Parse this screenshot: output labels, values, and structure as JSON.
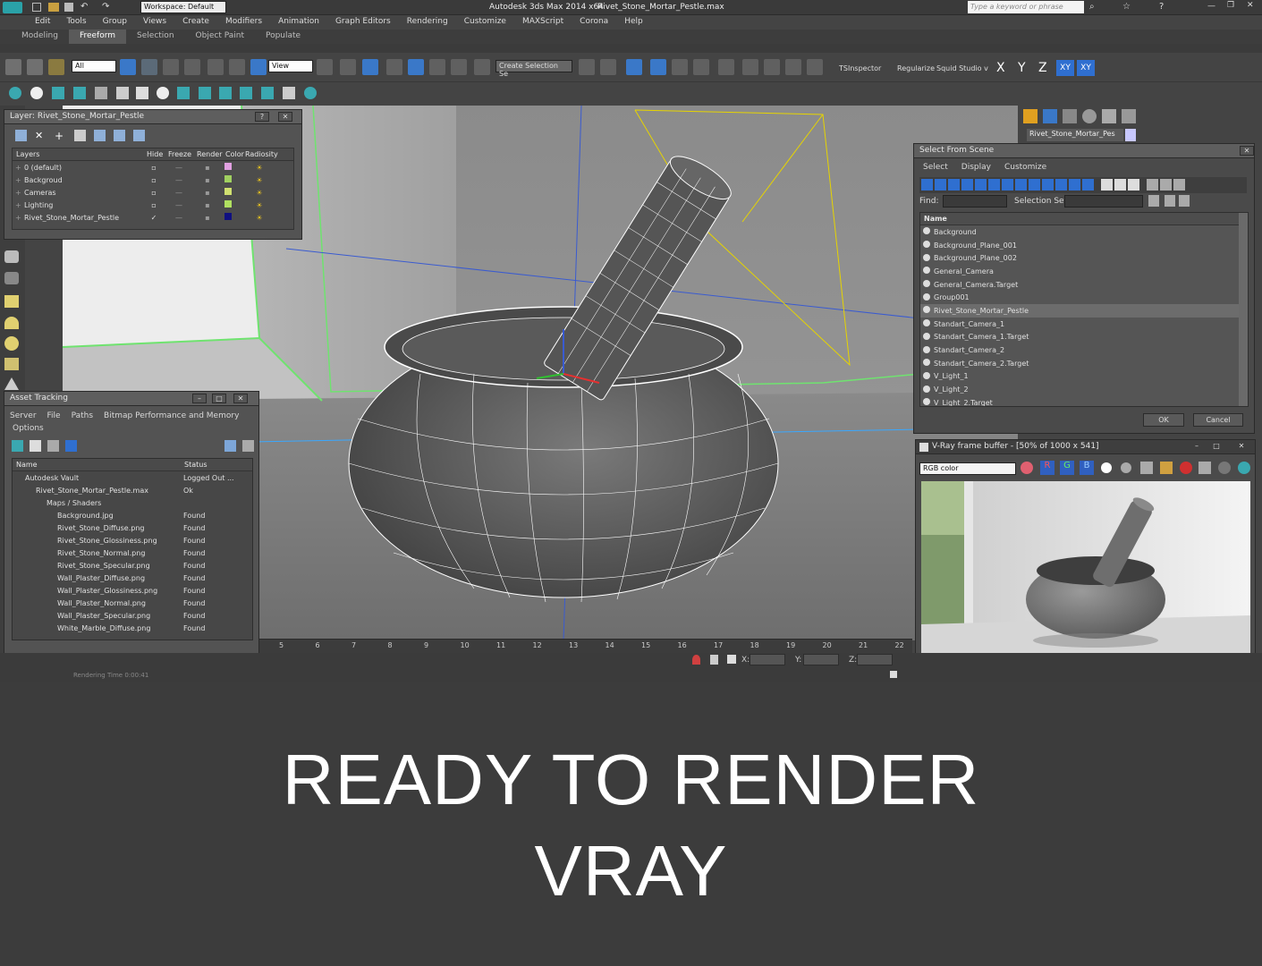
{
  "app": {
    "title": "Autodesk 3ds Max  2014 x64",
    "file": "Rivet_Stone_Mortar_Pestle.max",
    "workspace": "Workspace: Default",
    "search_placeholder": "Type a keyword or phrase"
  },
  "menu": [
    "Edit",
    "Tools",
    "Group",
    "Views",
    "Create",
    "Modifiers",
    "Animation",
    "Graph Editors",
    "Rendering",
    "Customize",
    "MAXScript",
    "Corona",
    "Help"
  ],
  "ribbon_tabs": [
    "Modeling",
    "Freeform",
    "Selection",
    "Object Paint",
    "Populate"
  ],
  "ribbon_active": "Freeform",
  "toolbar": {
    "filter": "All",
    "view": "View",
    "selection_set": "Create Selection Se",
    "tsinspector": "TSInspector",
    "regularize": "Regularize",
    "squid": "Squid Studio v",
    "axes": [
      "X",
      "Y",
      "Z",
      "XY",
      "XY"
    ]
  },
  "layer_panel": {
    "title": "Layer: Rivet_Stone_Mortar_Pestle",
    "columns": [
      "Layers",
      "Hide",
      "Freeze",
      "Render",
      "Color",
      "Radiosity"
    ],
    "rows": [
      {
        "name": "0 (default)",
        "color": "#e0a0e0"
      },
      {
        "name": "Backgroud",
        "color": "#a0d060"
      },
      {
        "name": "Cameras",
        "color": "#d0e070"
      },
      {
        "name": "Lighting",
        "color": "#b0e060"
      },
      {
        "name": "Rivet_Stone_Mortar_Pestle",
        "color": "#101080"
      }
    ]
  },
  "asset_panel": {
    "title": "Asset Tracking",
    "menu": [
      "Server",
      "File",
      "Paths",
      "Bitmap Performance and Memory"
    ],
    "menu2": "Options",
    "columns": [
      "Name",
      "Status"
    ],
    "rows": [
      {
        "name": "Autodesk Vault",
        "status": "Logged Out ...",
        "indent": 1
      },
      {
        "name": "Rivet_Stone_Mortar_Pestle.max",
        "status": "Ok",
        "indent": 2
      },
      {
        "name": "Maps / Shaders",
        "status": "",
        "indent": 3
      },
      {
        "name": "Background.jpg",
        "status": "Found",
        "indent": 4
      },
      {
        "name": "Rivet_Stone_Diffuse.png",
        "status": "Found",
        "indent": 4
      },
      {
        "name": "Rivet_Stone_Glossiness.png",
        "status": "Found",
        "indent": 4
      },
      {
        "name": "Rivet_Stone_Normal.png",
        "status": "Found",
        "indent": 4
      },
      {
        "name": "Rivet_Stone_Specular.png",
        "status": "Found",
        "indent": 4
      },
      {
        "name": "Wall_Plaster_Diffuse.png",
        "status": "Found",
        "indent": 4
      },
      {
        "name": "Wall_Plaster_Glossiness.png",
        "status": "Found",
        "indent": 4
      },
      {
        "name": "Wall_Plaster_Normal.png",
        "status": "Found",
        "indent": 4
      },
      {
        "name": "Wall_Plaster_Specular.png",
        "status": "Found",
        "indent": 4
      },
      {
        "name": "White_Marble_Diffuse.png",
        "status": "Found",
        "indent": 4
      }
    ]
  },
  "command_panel": {
    "object_name": "Rivet_Stone_Mortar_Pes"
  },
  "select_panel": {
    "title": "Select From Scene",
    "menu": [
      "Select",
      "Display",
      "Customize"
    ],
    "find_label": "Find:",
    "selset_label": "Selection Set:",
    "column": "Name",
    "items": [
      "Background",
      "Background_Plane_001",
      "Background_Plane_002",
      "General_Camera",
      "General_Camera.Target",
      "Group001",
      "Rivet_Stone_Mortar_Pestle",
      "Standart_Camera_1",
      "Standart_Camera_1.Target",
      "Standart_Camera_2",
      "Standart_Camera_2.Target",
      "V_Light_1",
      "V_Light_2",
      "V_Light_2.Target"
    ],
    "selected": "Rivet_Stone_Mortar_Pestle",
    "ok": "OK",
    "cancel": "Cancel"
  },
  "vfb": {
    "title": "V-Ray frame buffer - [50% of 1000 x 541]",
    "channel": "RGB color",
    "rgb": [
      "R",
      "G",
      "B"
    ]
  },
  "timeline": {
    "ticks": [
      "5",
      "6",
      "7",
      "8",
      "9",
      "10",
      "11",
      "12",
      "13",
      "14",
      "15",
      "16",
      "17",
      "18",
      "19",
      "20",
      "21",
      "22"
    ]
  },
  "status": {
    "x_label": "X:",
    "y_label": "Y:",
    "z_label": "Z:",
    "render_time": "Rendering Time 0:00:41"
  },
  "caption": {
    "line1": "READY TO RENDER",
    "line2": "VRAY"
  },
  "colors": {
    "ui_bg": "#444444",
    "caption_bg": "#3c3c3c",
    "highlight": "#2f6fd0",
    "wire_green": "#6fe36f",
    "wire_blue": "#3aa8ff",
    "wire_yellow": "#e6d400"
  }
}
